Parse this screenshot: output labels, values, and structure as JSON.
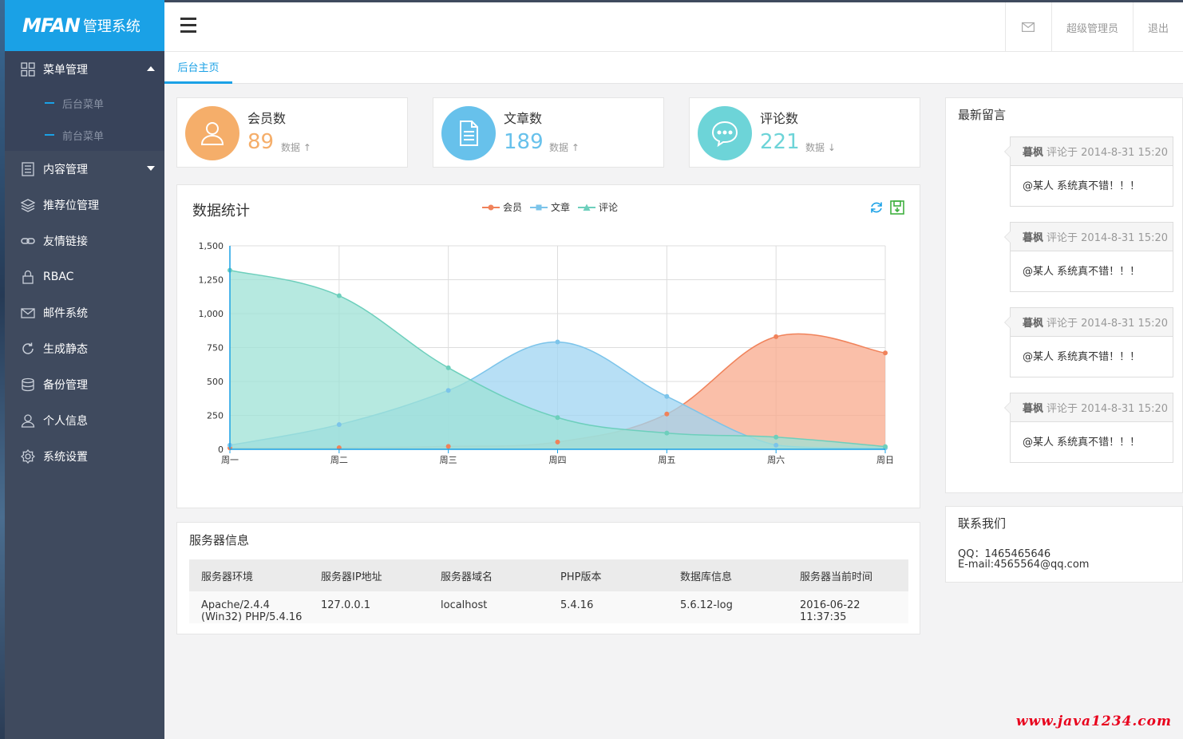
{
  "brand": {
    "logo": "MFAN",
    "suffix": "管理系统"
  },
  "sidebar": {
    "items": [
      {
        "label": "菜单管理",
        "icon": "grid-icon",
        "open": true,
        "children": [
          {
            "label": "后台菜单"
          },
          {
            "label": "前台菜单"
          }
        ]
      },
      {
        "label": "内容管理",
        "icon": "document-list-icon"
      },
      {
        "label": "推荐位管理",
        "icon": "layers-icon"
      },
      {
        "label": "友情链接",
        "icon": "link-icon"
      },
      {
        "label": "RBAC",
        "icon": "lock-icon"
      },
      {
        "label": "邮件系统",
        "icon": "envelope-icon"
      },
      {
        "label": "生成静态",
        "icon": "refresh-icon"
      },
      {
        "label": "备份管理",
        "icon": "database-icon"
      },
      {
        "label": "个人信息",
        "icon": "user-icon"
      },
      {
        "label": "系统设置",
        "icon": "gear-icon"
      }
    ]
  },
  "topbar": {
    "admin_label": "超级管理员",
    "logout_label": "退出"
  },
  "tabs": [
    {
      "label": "后台主页"
    }
  ],
  "stats": [
    {
      "label": "会员数",
      "value": "89",
      "sub": "数据",
      "color": "#f5ae6a",
      "trend": "up",
      "icon": "user-icon"
    },
    {
      "label": "文章数",
      "value": "189",
      "sub": "数据",
      "color": "#67c1eb",
      "trend": "up",
      "icon": "document-icon"
    },
    {
      "label": "评论数",
      "value": "221",
      "sub": "数据",
      "color": "#6dd4d8",
      "trend": "down",
      "icon": "chat-bubble-icon"
    }
  ],
  "chart_title": "数据统计",
  "chart_data": {
    "type": "area",
    "categories": [
      "周一",
      "周二",
      "周三",
      "周四",
      "周五",
      "周六",
      "周日"
    ],
    "ylim": [
      0,
      1500
    ],
    "yticks": [
      "0",
      "250",
      "500",
      "750",
      "1,000",
      "1,250",
      "1,500"
    ],
    "smooth": true,
    "grid": true,
    "legend_position": "top-center",
    "series": [
      {
        "name": "会员",
        "values": [
          10,
          12,
          21,
          54,
          260,
          830,
          710
        ],
        "color": "#f0825a",
        "fill": "#f8a98c"
      },
      {
        "name": "文章",
        "values": [
          30,
          182,
          434,
          791,
          390,
          30,
          10
        ],
        "color": "#7cc4ea",
        "fill": "#9fd4f2"
      },
      {
        "name": "评论",
        "values": [
          1320,
          1132,
          601,
          234,
          120,
          90,
          20
        ],
        "color": "#6dcfbc",
        "fill": "#9ee2d5"
      }
    ]
  },
  "server": {
    "title": "服务器信息",
    "columns": [
      "服务器环境",
      "服务器IP地址",
      "服务器域名",
      "PHP版本",
      "数据库信息",
      "服务器当前时间"
    ],
    "row": [
      "Apache/2.4.4 (Win32) PHP/5.4.16",
      "127.0.0.1",
      "localhost",
      "5.4.16",
      "5.6.12-log",
      "2016-06-22 11:37:35"
    ]
  },
  "messages": {
    "title": "最新留言",
    "items": [
      {
        "author": "暮枫",
        "meta": "评论于 2014-8-31 15:20",
        "text": "@某人 系统真不错！！！"
      },
      {
        "author": "暮枫",
        "meta": "评论于 2014-8-31 15:20",
        "text": "@某人 系统真不错！！！"
      },
      {
        "author": "暮枫",
        "meta": "评论于 2014-8-31 15:20",
        "text": "@某人 系统真不错！！！"
      },
      {
        "author": "暮枫",
        "meta": "评论于 2014-8-31 15:20",
        "text": "@某人 系统真不错！！！"
      }
    ]
  },
  "contact": {
    "title": "联系我们",
    "qq": "QQ：1465465646",
    "email": "E-mail:4565564@qq.com"
  },
  "watermark": "www.java1234.com",
  "colors": {
    "sidebar": "#3f4a5e",
    "brand": "#1aa1e6"
  }
}
